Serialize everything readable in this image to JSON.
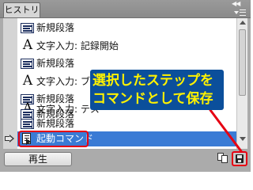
{
  "panel": {
    "tab_label": "ヒストリ",
    "collapse_glyph": "◀◀"
  },
  "history": {
    "items": [
      {
        "icon": "paragraph-icon",
        "label": "新規段落"
      },
      {
        "icon": "text-input-icon",
        "label": "文字入力: 記録開始"
      },
      {
        "icon": "paragraph-icon",
        "label": "新規段落"
      },
      {
        "icon": "text-input-icon",
        "label": "文字入力: ブ"
      },
      {
        "icon": "paragraph-icon",
        "label": "新規段落"
      },
      {
        "icon": "text-input-icon",
        "label": "文字入力: テス"
      },
      {
        "icon": "paragraph-icon",
        "label": "新規段落"
      },
      {
        "icon": "paragraph-icon",
        "label": "新規段落"
      },
      {
        "icon": "command-icon",
        "label": "起動コマンド",
        "selected": true
      }
    ],
    "text_icon_glyph": "A"
  },
  "callout": {
    "line1": "選択したステップを",
    "line2": "コマンドとして保存"
  },
  "footer": {
    "play_label": "再生"
  },
  "colors": {
    "selection": "#3a7bd5",
    "highlight": "#e60012",
    "callout_bg": "#0b4f9b",
    "callout_text": "#fff200"
  }
}
